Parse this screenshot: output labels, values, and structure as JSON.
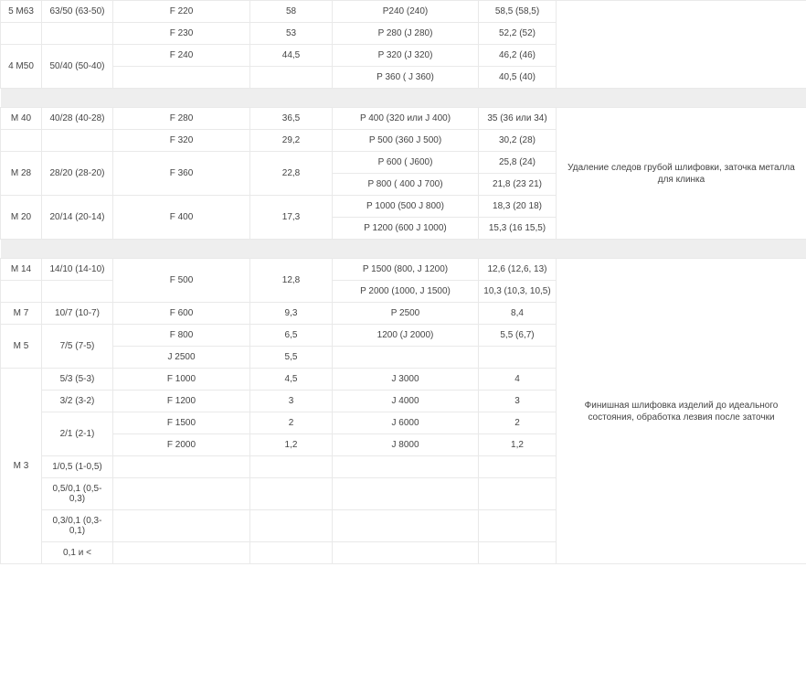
{
  "sections": [
    {
      "note": "",
      "rows": [
        {
          "c1": "5 М63",
          "c2": "63/50 (63-50)",
          "c3": "F 220",
          "c4": "58",
          "c5": "P240 (240)",
          "c6": "58,5 (58,5)",
          "rs1": 1,
          "rs2": 1
        },
        {
          "c3": "F 230",
          "c4": "53",
          "c5": "P 280 (J 280)",
          "c6": "52,2 (52)"
        },
        {
          "c1": "4 М50",
          "c2": "50/40 (50-40)",
          "c3": "F 240",
          "c4": "44,5",
          "c5": "P 320 (J 320)",
          "c6": "46,2 (46)",
          "rs1": 2,
          "rs2": 2
        },
        {
          "c3": "",
          "c4": "",
          "c5": "P 360 ( J 360)",
          "c6": "40,5 (40)"
        }
      ]
    },
    {
      "note": "Удаление следов грубой шлифовки, заточка металла для клинка",
      "rows": [
        {
          "c1": "М 40",
          "c2": "40/28 (40-28)",
          "c3": "F 280",
          "c4": "36,5",
          "c5": "P 400 (320 или J 400)",
          "c6": "35 (36 или 34)",
          "rs1": 1,
          "rs2": 1
        },
        {
          "c3": "F 320",
          "c4": "29,2",
          "c5": "P 500 (360 J 500)",
          "c6": "30,2 (28)"
        },
        {
          "c1": "М 28",
          "c2": "28/20 (28-20)",
          "c3": "F 360",
          "c4": "22,8",
          "c5": "P 600 ( J600)",
          "c6": "25,8 (24)",
          "rs1": 2,
          "rs2": 2,
          "rs3": 2,
          "rs4": 2
        },
        {
          "c5": "P 800 ( 400 J 700)",
          "c6": "21,8 (23 21)"
        },
        {
          "c1": "М 20",
          "c2": "20/14 (20-14)",
          "c3": "F 400",
          "c4": "17,3",
          "c5": "P 1000 (500 J 800)",
          "c6": "18,3 (20 18)",
          "rs1": 2,
          "rs2": 2,
          "rs3": 2,
          "rs4": 2
        },
        {
          "c5": "P 1200 (600 J 1000)",
          "c6": "15,3 (16 15,5)"
        }
      ]
    },
    {
      "note": "Финишная шлифовка изделий до идеального состояния, обработка лезвия после заточки",
      "rows": [
        {
          "c1": "М 14",
          "c2": "14/10 (14-10)",
          "c3": "F 500",
          "c4": "12,8",
          "c5": "P 1500 (800, J 1200)",
          "c6": "12,6 (12,6, 13)",
          "rs1": 1,
          "rs2": 1,
          "rs3": 2,
          "rs4": 2
        },
        {
          "c5": "P 2000 (1000, J 1500)",
          "c6": "10,3 (10,3, 10,5)"
        },
        {
          "c1": "М 7",
          "c2": "10/7 (10-7)",
          "c3": "F 600",
          "c4": "9,3",
          "c5": "P 2500",
          "c6": "8,4",
          "rs1": 1,
          "rs2": 1
        },
        {
          "c1": "М 5",
          "c2": "7/5 (7-5)",
          "c3": "F 800",
          "c4": "6,5",
          "c5": "1200 (J 2000)",
          "c6": "5,5 (6,7)",
          "rs1": 2,
          "rs2": 2
        },
        {
          "c3": "J 2500",
          "c4": "5,5",
          "c5": "",
          "c6": ""
        },
        {
          "c1": "М 3",
          "c2": "5/3 (5-3)",
          "c3": "F 1000",
          "c4": "4,5",
          "c5": "J 3000",
          "c6": "4",
          "rs1": 9
        },
        {
          "c2": "3/2 (3-2)",
          "c3": "F 1200",
          "c4": "3",
          "c5": "J 4000",
          "c6": "3"
        },
        {
          "c2": "2/1 (2-1)",
          "c3": "F 1500",
          "c4": "2",
          "c5": "J 6000",
          "c6": "2",
          "rs2": 2
        },
        {
          "c3": "F 2000",
          "c4": "1,2",
          "c5": "J 8000",
          "c6": "1,2"
        },
        {
          "c2": "1/0,5 (1-0,5)",
          "c3": "",
          "c4": "",
          "c5": "",
          "c6": ""
        },
        {
          "c2": "0,5/0,1 (0,5-0,3)",
          "c3": "",
          "c4": "",
          "c5": "",
          "c6": ""
        },
        {
          "c2": "0,3/0,1 (0,3-0,1)",
          "c3": "",
          "c4": "",
          "c5": "",
          "c6": ""
        },
        {
          "c2": "0,1 и <",
          "c3": "",
          "c4": "",
          "c5": "",
          "c6": ""
        }
      ]
    }
  ]
}
